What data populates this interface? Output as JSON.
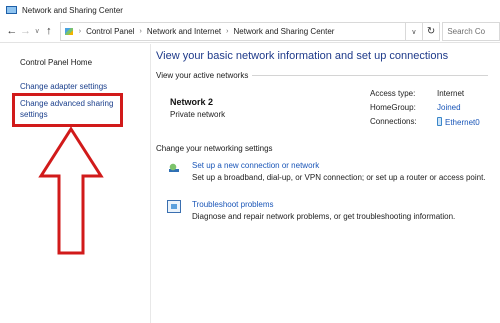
{
  "window": {
    "title": "Network and Sharing Center"
  },
  "addressbar": {
    "crumbs": [
      "Control Panel",
      "Network and Internet",
      "Network and Sharing Center"
    ],
    "search_placeholder": "Search Co"
  },
  "sidebar": {
    "home": "Control Panel Home",
    "adapter": "Change adapter settings",
    "advanced_line1": "Change advanced sharing",
    "advanced_line2": "settings"
  },
  "main": {
    "heading": "View your basic network information and set up connections",
    "active_label": "View your active networks",
    "network": {
      "name": "Network  2",
      "type": "Private network",
      "access_type_label": "Access type:",
      "access_type_value": "Internet",
      "homegroup_label": "HomeGroup:",
      "homegroup_value": "Joined",
      "connections_label": "Connections:",
      "connections_value": "Ethernet0"
    },
    "change_label": "Change your networking settings",
    "tasks": [
      {
        "link": "Set up a new connection or network",
        "desc": "Set up a broadband, dial-up, or VPN connection; or set up a router or access point."
      },
      {
        "link": "Troubleshoot problems",
        "desc": "Diagnose and repair network problems, or get troubleshooting information."
      }
    ]
  },
  "annotation": {
    "color": "#d11a1a"
  }
}
